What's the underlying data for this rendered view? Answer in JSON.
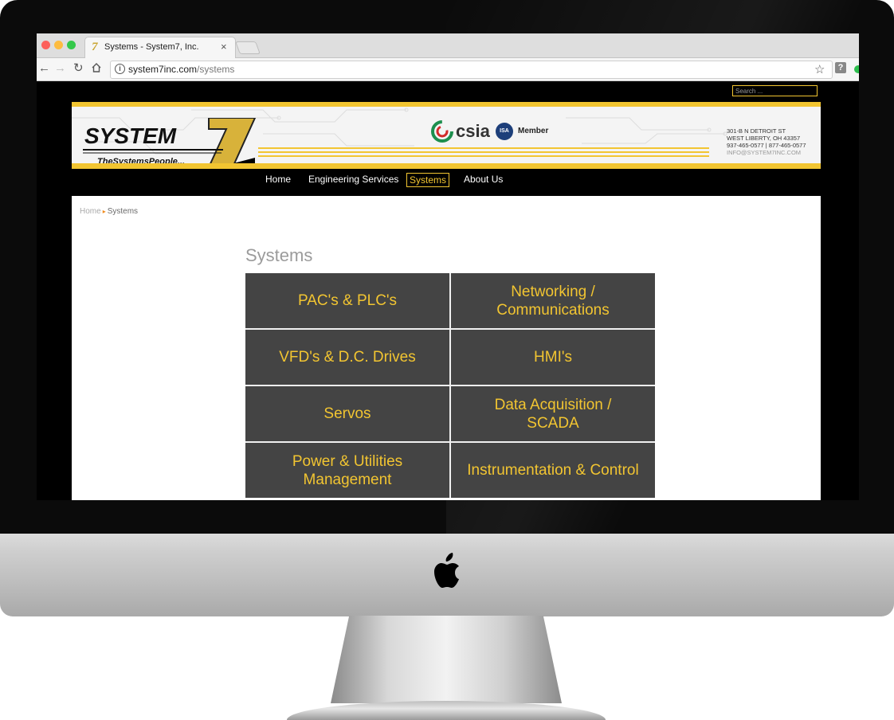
{
  "browser": {
    "tab_title": "Systems - System7, Inc.",
    "favicon_glyph": "7",
    "tab_close": "×",
    "url_domain": "system7inc.com",
    "url_path": "/systems",
    "ext_glyph": "?"
  },
  "site": {
    "search_placeholder": "Search ...",
    "logo_main": "SYSTEM",
    "logo_seven": "7",
    "logo_tagline": "TheSystemsPeople...",
    "csia_text": "csia",
    "isa_text": "ISA",
    "member_text": "Member",
    "address": {
      "line1": "301-B N DETROIT ST",
      "line2": "WEST LIBERTY, OH 43357",
      "line3": "937-465-0577 | 877-465-0577",
      "email": "INFO@SYSTEM7INC.COM"
    },
    "nav": [
      {
        "label": "Home"
      },
      {
        "label": "Engineering Services"
      },
      {
        "label": "Systems",
        "active": true
      },
      {
        "label": "About Us"
      }
    ],
    "breadcrumb": {
      "home": "Home",
      "arrow": "▸",
      "current": "Systems"
    },
    "page_title": "Systems",
    "tiles": [
      "PAC's & PLC's",
      "Networking / Communications",
      "VFD's & D.C. Drives",
      "HMI's",
      "Servos",
      "Data Acquisition / SCADA",
      "Power & Utilities Management",
      "Instrumentation & Control"
    ]
  },
  "colors": {
    "brand_gold": "#f2c531",
    "tile_bg": "#444444",
    "traffic_close": "#fc605b",
    "traffic_min": "#fdbc40",
    "traffic_max": "#34c84a"
  },
  "icons": {
    "back": "back-arrow-icon",
    "forward": "forward-arrow-icon",
    "reload": "reload-icon",
    "home": "home-icon",
    "info": "info-icon",
    "star": "bookmark-star-icon",
    "apple": "apple-logo-icon"
  }
}
